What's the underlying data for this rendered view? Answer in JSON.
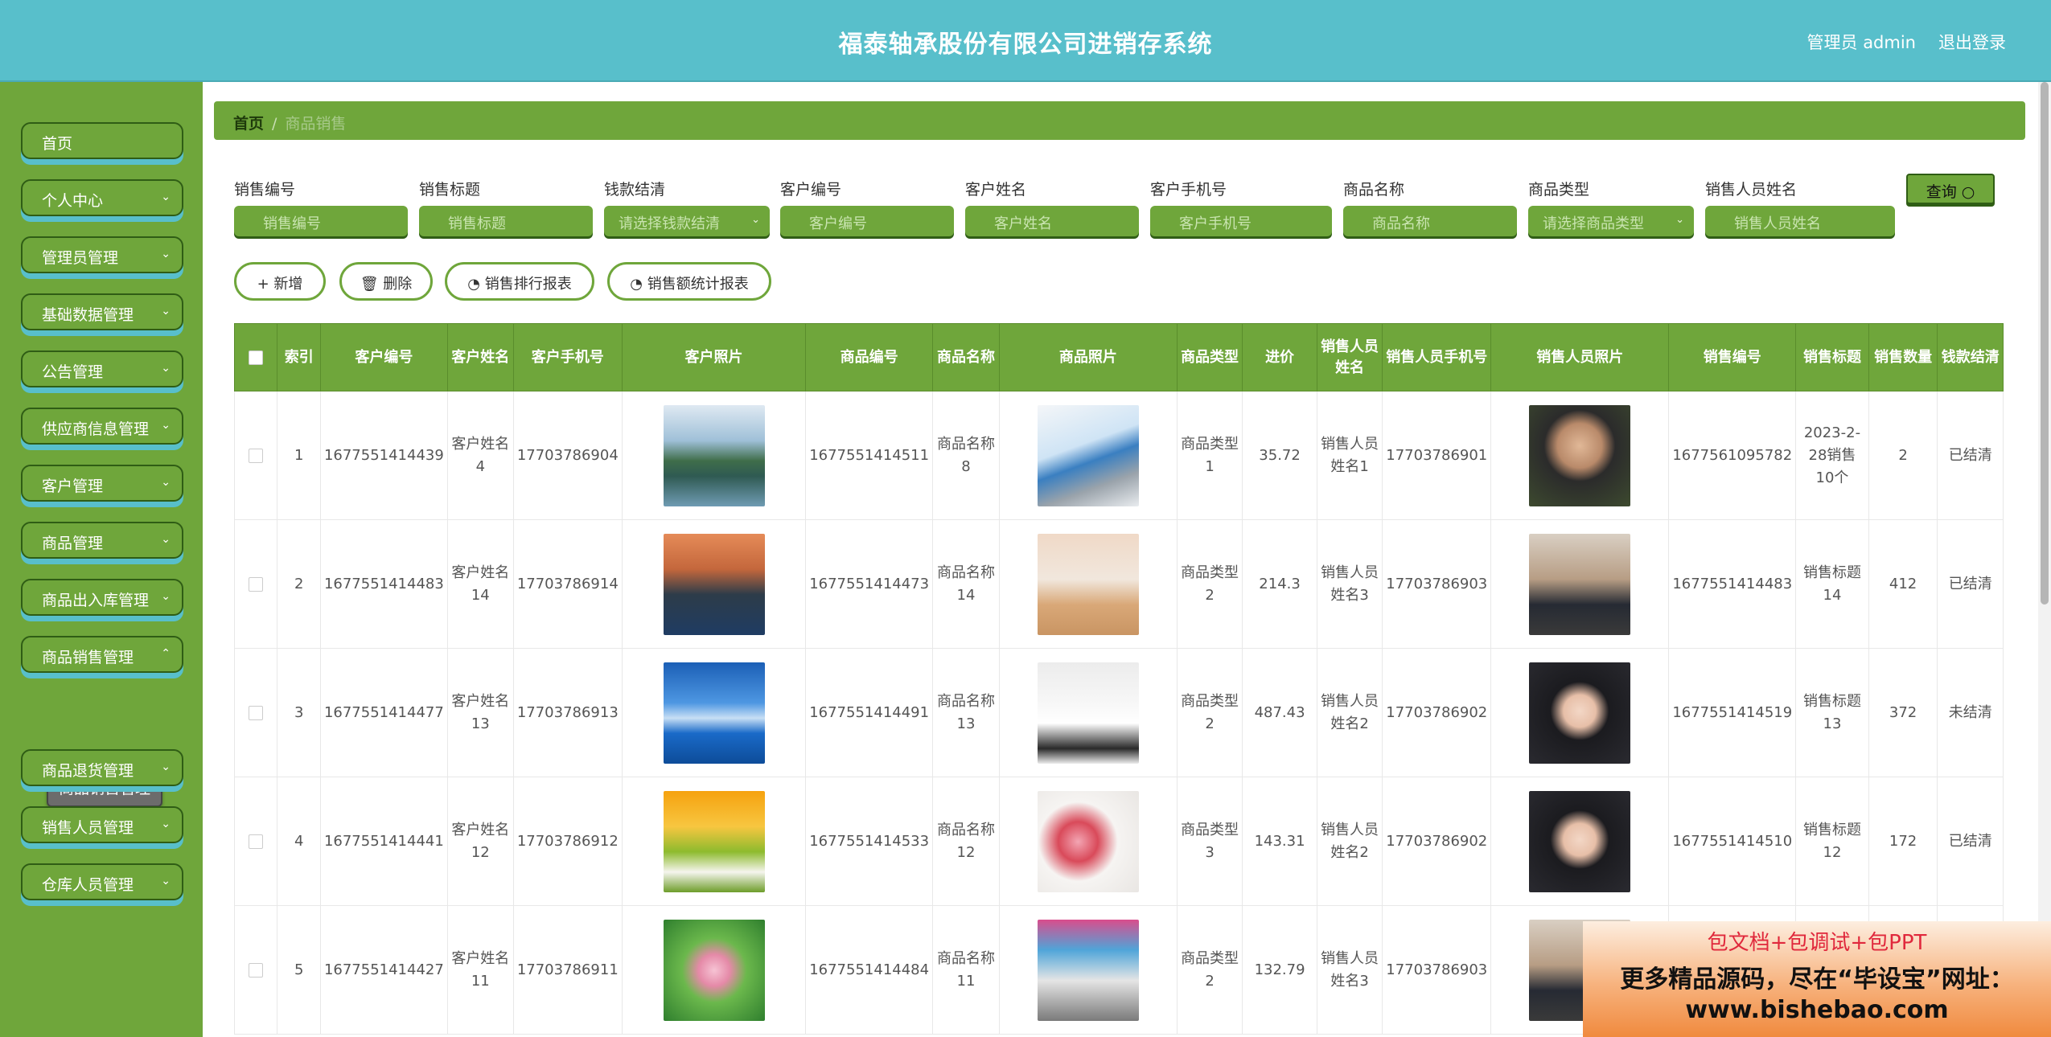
{
  "header": {
    "title": "福泰轴承股份有限公司进销存系统",
    "user": "管理员 admin",
    "logout": "退出登录"
  },
  "sidebar": {
    "items": [
      {
        "label": "首页",
        "has_chevron": false
      },
      {
        "label": "个人中心",
        "has_chevron": true
      },
      {
        "label": "管理员管理",
        "has_chevron": true
      },
      {
        "label": "基础数据管理",
        "has_chevron": true
      },
      {
        "label": "公告管理",
        "has_chevron": true
      },
      {
        "label": "供应商信息管理",
        "has_chevron": true
      },
      {
        "label": "客户管理",
        "has_chevron": true
      },
      {
        "label": "商品管理",
        "has_chevron": true
      },
      {
        "label": "商品出入库管理",
        "has_chevron": true
      },
      {
        "label": "商品销售管理",
        "has_chevron": true
      },
      {
        "label": "商品退货管理",
        "has_chevron": true
      },
      {
        "label": "销售人员管理",
        "has_chevron": true
      },
      {
        "label": "仓库人员管理",
        "has_chevron": true
      }
    ],
    "submenu_active": "商品销售管理"
  },
  "breadcrumb": {
    "home": "首页",
    "separator": "/",
    "current": "商品销售"
  },
  "search": {
    "fields": [
      {
        "label": "销售编号",
        "placeholder": "销售编号"
      },
      {
        "label": "销售标题",
        "placeholder": "销售标题"
      },
      {
        "label": "钱款结清",
        "placeholder": "请选择钱款结清"
      },
      {
        "label": "客户编号",
        "placeholder": "客户编号"
      },
      {
        "label": "客户姓名",
        "placeholder": "客户姓名"
      },
      {
        "label": "客户手机号",
        "placeholder": "客户手机号"
      },
      {
        "label": "商品名称",
        "placeholder": "商品名称"
      },
      {
        "label": "商品类型",
        "placeholder": "请选择商品类型"
      },
      {
        "label": "销售人员姓名",
        "placeholder": "销售人员姓名"
      }
    ],
    "query_label": "查询 ○"
  },
  "actions": {
    "add": "+ 新增",
    "delete": "🗑 删除",
    "rank_report": "◔ 销售排行报表",
    "stat_report": "◔ 销售额统计报表"
  },
  "table": {
    "columns": [
      "",
      "索引",
      "客户编号",
      "客户姓名",
      "客户手机号",
      "客户照片",
      "商品编号",
      "商品名称",
      "商品照片",
      "商品类型",
      "进价",
      "销售人员姓名",
      "销售人员手机号",
      "销售人员照片",
      "销售编号",
      "销售标题",
      "销售数量",
      "钱款结清"
    ],
    "rows": [
      {
        "index": "1",
        "customer_no": "1677551414439",
        "customer_name": "客户姓名4",
        "customer_phone": "17703786904",
        "customer_photo": "mountain-lake-photo",
        "product_no": "1677551414511",
        "product_name": "商品名称8",
        "product_photo": "laptop-photo",
        "product_type": "商品类型1",
        "price": "35.72",
        "seller_name": "销售人员姓名1",
        "seller_phone": "17703786901",
        "seller_photo": "man-portrait-photo",
        "sale_no": "1677561095782",
        "sale_title": "2023-2-28销售10个",
        "sale_qty": "2",
        "settled": "已结清"
      },
      {
        "index": "2",
        "customer_no": "1677551414483",
        "customer_name": "客户姓名14",
        "customer_phone": "17703786914",
        "customer_photo": "sunset-lake-photo",
        "product_no": "1677551414473",
        "product_name": "商品名称14",
        "product_photo": "tools-box-photo",
        "product_type": "商品类型2",
        "price": "214.3",
        "seller_name": "销售人员姓名3",
        "seller_phone": "17703786903",
        "seller_photo": "woman-gallery-photo",
        "sale_no": "1677551414483",
        "sale_title": "销售标题14",
        "sale_qty": "412",
        "settled": "已结清"
      },
      {
        "index": "3",
        "customer_no": "1677551414477",
        "customer_name": "客户姓名13",
        "customer_phone": "17703786913",
        "customer_photo": "sea-sky-photo",
        "product_no": "1677551414491",
        "product_name": "商品名称13",
        "product_photo": "white-shirt-photo",
        "product_type": "商品类型2",
        "price": "487.43",
        "seller_name": "销售人员姓名2",
        "seller_phone": "17703786902",
        "seller_photo": "woman-portrait-photo",
        "sale_no": "1677551414519",
        "sale_title": "销售标题13",
        "sale_qty": "372",
        "settled": "未结清"
      },
      {
        "index": "4",
        "customer_no": "1677551414441",
        "customer_name": "客户姓名12",
        "customer_phone": "17703786912",
        "customer_photo": "flower-field-photo",
        "product_no": "1677551414533",
        "product_name": "商品名称12",
        "product_photo": "flowers-photo",
        "product_type": "商品类型3",
        "price": "143.31",
        "seller_name": "销售人员姓名2",
        "seller_phone": "17703786902",
        "seller_photo": "woman-portrait-photo",
        "sale_no": "1677551414510",
        "sale_title": "销售标题12",
        "sale_qty": "172",
        "settled": "已结清"
      },
      {
        "index": "5",
        "customer_no": "1677551414427",
        "customer_name": "客户姓名11",
        "customer_phone": "17703786911",
        "customer_photo": "lotus-photo",
        "product_no": "1677551414484",
        "product_name": "商品名称11",
        "product_photo": "baskets-photo",
        "product_type": "商品类型2",
        "price": "132.79",
        "seller_name": "销售人员姓名3",
        "seller_phone": "17703786903",
        "seller_photo": "woman-gallery-photo",
        "sale_no": "",
        "sale_title": "",
        "sale_qty": "",
        "settled": ""
      }
    ]
  },
  "promo": {
    "line1": "包文档+包调试+包PPT",
    "line2": "更多精品源码，尽在“毕设宝”网址：",
    "line3": "www.bishebao.com"
  },
  "colors": {
    "header": "#58bfcb",
    "green": "#6fa63b",
    "dark_green": "#2f5d15"
  }
}
